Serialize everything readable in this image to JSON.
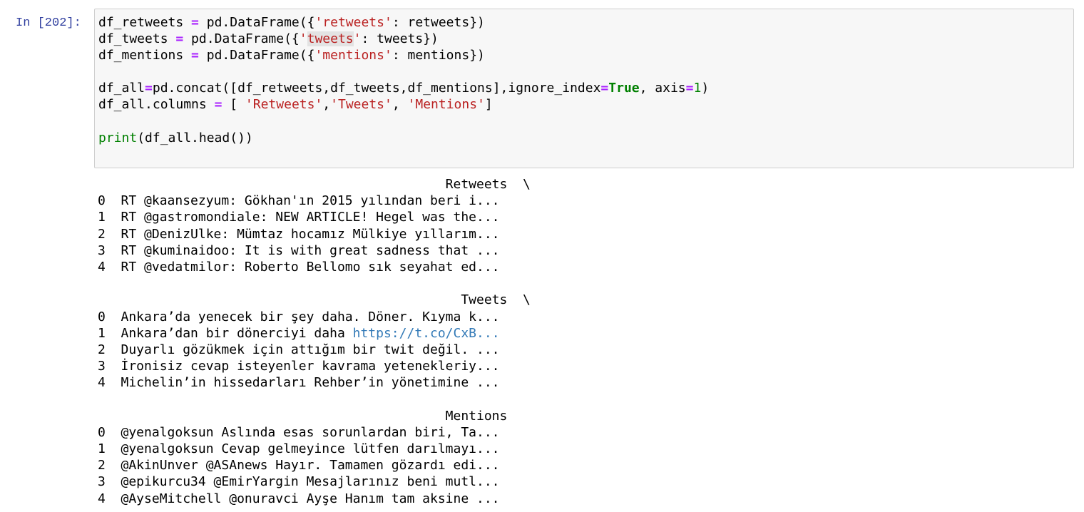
{
  "cell": {
    "prompt": "In [202]:",
    "code_lines": [
      [
        {
          "t": "df_retweets ",
          "c": ""
        },
        {
          "t": "=",
          "c": "op"
        },
        {
          "t": " pd.DataFrame({",
          "c": ""
        },
        {
          "t": "'retweets'",
          "c": "str"
        },
        {
          "t": ": retweets})",
          "c": ""
        }
      ],
      [
        {
          "t": "df_tweets ",
          "c": ""
        },
        {
          "t": "=",
          "c": "op"
        },
        {
          "t": " pd.DataFrame({",
          "c": ""
        },
        {
          "t": "'",
          "c": "str"
        },
        {
          "t": "tweets",
          "c": "str-hl"
        },
        {
          "t": "'",
          "c": "str"
        },
        {
          "t": ": tweets})",
          "c": ""
        }
      ],
      [
        {
          "t": "df_mentions ",
          "c": ""
        },
        {
          "t": "=",
          "c": "op"
        },
        {
          "t": " pd.DataFrame({",
          "c": ""
        },
        {
          "t": "'mentions'",
          "c": "str"
        },
        {
          "t": ": mentions})",
          "c": ""
        }
      ],
      [],
      [
        {
          "t": "df_all",
          "c": ""
        },
        {
          "t": "=",
          "c": "op"
        },
        {
          "t": "pd.concat([df_retweets,df_tweets,df_mentions],ignore_index",
          "c": ""
        },
        {
          "t": "=",
          "c": "op"
        },
        {
          "t": "True",
          "c": "kw"
        },
        {
          "t": ", axis",
          "c": ""
        },
        {
          "t": "=",
          "c": "op"
        },
        {
          "t": "1",
          "c": "num"
        },
        {
          "t": ")",
          "c": ""
        }
      ],
      [
        {
          "t": "df_all.columns ",
          "c": ""
        },
        {
          "t": "=",
          "c": "op"
        },
        {
          "t": " [ ",
          "c": ""
        },
        {
          "t": "'Retweets'",
          "c": "str"
        },
        {
          "t": ",",
          "c": ""
        },
        {
          "t": "'Tweets'",
          "c": "str"
        },
        {
          "t": ", ",
          "c": ""
        },
        {
          "t": "'Mentions'",
          "c": "str"
        },
        {
          "t": "]",
          "c": ""
        }
      ],
      [],
      [
        {
          "t": "print",
          "c": "builtin"
        },
        {
          "t": "(df_all.head())",
          "c": ""
        }
      ]
    ],
    "output_lines": [
      [
        {
          "t": "                                             Retweets  \\",
          "c": ""
        }
      ],
      [
        {
          "t": "0  RT @kaansezyum: Gökhan'ın 2015 yılından beri i...",
          "c": ""
        }
      ],
      [
        {
          "t": "1  RT @gastromondiale: NEW ARTICLE! Hegel was the...",
          "c": ""
        }
      ],
      [
        {
          "t": "2  RT @DenizUlke: Mümtaz hocamız Mülkiye yıllarım...",
          "c": ""
        }
      ],
      [
        {
          "t": "3  RT @kuminaidoo: It is with great sadness that ...",
          "c": ""
        }
      ],
      [
        {
          "t": "4  RT @vedatmilor: Roberto Bellomo sık seyahat ed...",
          "c": ""
        }
      ],
      [],
      [
        {
          "t": "                                               Tweets  \\",
          "c": ""
        }
      ],
      [
        {
          "t": "0  Ankara’da yenecek bir şey daha. Döner. Kıyma k...",
          "c": ""
        }
      ],
      [
        {
          "t": "1  Ankara’dan bir dönerciyi daha ",
          "c": ""
        },
        {
          "t": "https://t.co/CxB...",
          "c": "link"
        }
      ],
      [
        {
          "t": "2  Duyarlı gözükmek için attığım bir twit değil. ...",
          "c": ""
        }
      ],
      [
        {
          "t": "3  İronisiz cevap isteyenler kavrama yetenekleriy...",
          "c": ""
        }
      ],
      [
        {
          "t": "4  Michelin’in hissedarları Rehber’in yönetimine ...",
          "c": ""
        }
      ],
      [],
      [
        {
          "t": "                                             Mentions",
          "c": ""
        }
      ],
      [
        {
          "t": "0  @yenalgoksun Aslında esas sorunlardan biri, Ta...",
          "c": ""
        }
      ],
      [
        {
          "t": "1  @yenalgoksun Cevap gelmeyince lütfen darılmayı...",
          "c": ""
        }
      ],
      [
        {
          "t": "2  @AkinUnver @ASAnews Hayır. Tamamen gözardı edi...",
          "c": ""
        }
      ],
      [
        {
          "t": "3  @epikurcu34 @EmirYargin Mesajlarınız beni mutl...",
          "c": ""
        }
      ],
      [
        {
          "t": "4  @AyseMitchell @onuravci Ayşe Hanım tam aksine ...",
          "c": ""
        }
      ]
    ]
  },
  "colors": {
    "prompt": "#303f9f",
    "operator": "#aa22ff",
    "string": "#ba2121",
    "keyword": "#008000",
    "link": "#337ab7",
    "input_background": "#f7f7f7",
    "input_border": "#cfcfcf"
  }
}
